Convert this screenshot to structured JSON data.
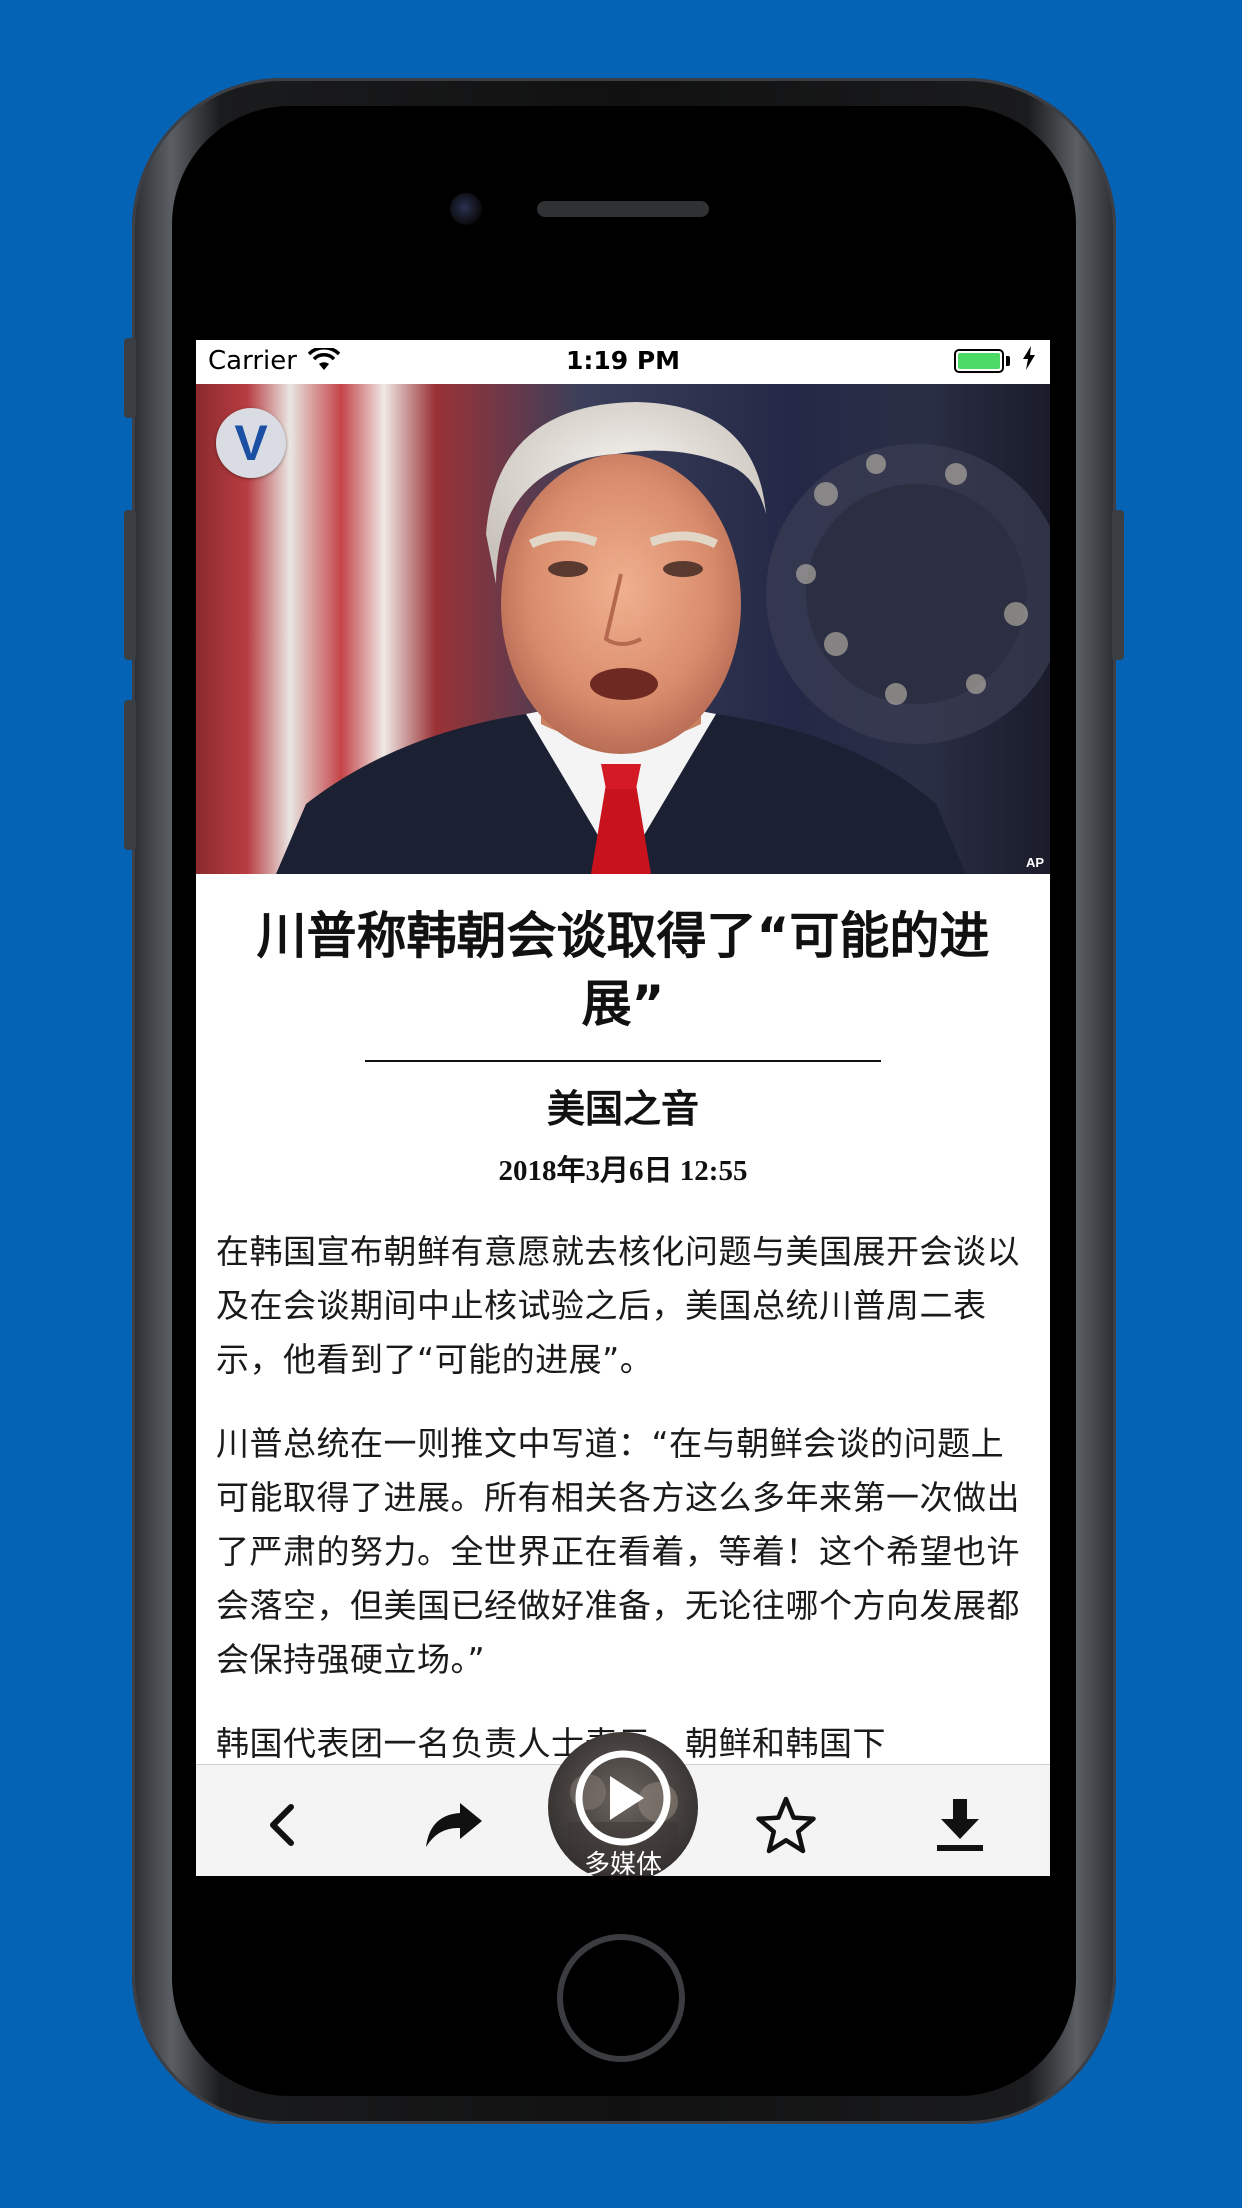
{
  "status_bar": {
    "carrier": "Carrier",
    "time": "1:19 PM",
    "battery_level": 1.0
  },
  "hero": {
    "logo_letter": "V",
    "photo_credit": "AP"
  },
  "article": {
    "headline": "川普称韩朝会谈取得了“可能的进展”",
    "source": "美国之音",
    "date": "2018年3月6日 12:55",
    "paragraphs": [
      "在韩国宣布朝鲜有意愿就去核化问题与美国展开会谈以及在会谈期间中止核试验之后，美国总统川普周二表示，他看到了“可能的进展”。",
      "川普总统在一则推文中写道：“在与朝鲜会谈的问题上可能取得了进展。所有相关各方这么多年来第一次做出了严肃的努力。全世界正在看着，等着！这个希望也许会落空，但美国已经做好准备，无论往哪个方向发展都会保持强硬立场。”",
      "韩国代表团一名负责人士表示，朝鲜和韩国下"
    ]
  },
  "toolbar": {
    "media_label": "多媒体",
    "icons": [
      "back-icon",
      "share-icon",
      "play-icon",
      "favorite-star-icon",
      "download-icon"
    ]
  },
  "colors": {
    "background": "#0563b6",
    "battery": "#4cd964"
  }
}
